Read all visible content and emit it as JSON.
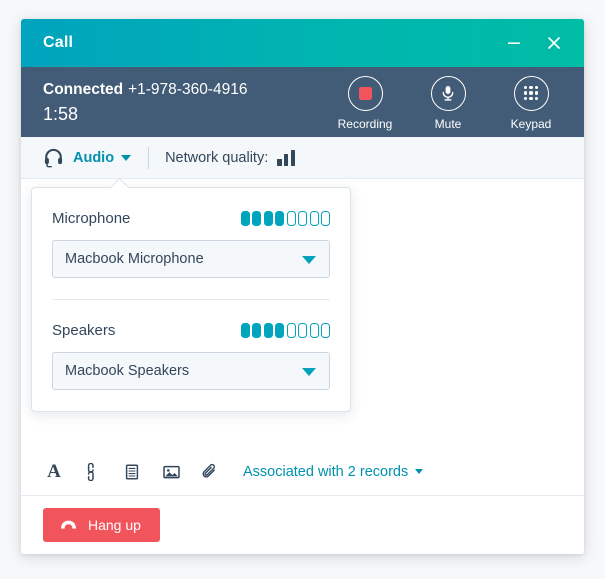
{
  "window": {
    "title": "Call",
    "minimize_icon": "minimize-icon",
    "close_icon": "close-icon"
  },
  "status": {
    "state_label": "Connected",
    "phone_number": "+1-978-360-4916",
    "timer": "1:58",
    "controls": [
      {
        "label": "Recording",
        "icon": "record-stop-icon"
      },
      {
        "label": "Mute",
        "icon": "microphone-icon"
      },
      {
        "label": "Keypad",
        "icon": "keypad-grid-icon"
      }
    ]
  },
  "audio_bar": {
    "headset_icon": "headset-icon",
    "audio_label": "Audio",
    "network_quality_label": "Network quality:",
    "signal_icon": "signal-bars-icon",
    "signal_bars_filled": 3,
    "signal_bars_total": 3
  },
  "audio_panel": {
    "microphone": {
      "title": "Microphone",
      "level_filled": 4,
      "level_total": 8,
      "selected_device": "Macbook Microphone"
    },
    "speakers": {
      "title": "Speakers",
      "level_filled": 4,
      "level_total": 8,
      "selected_device": "Macbook Speakers"
    }
  },
  "bottom_toolbar": {
    "icons": [
      {
        "name": "text-format-icon",
        "glyph": "A"
      },
      {
        "name": "link-icon",
        "glyph": ""
      },
      {
        "name": "snippet-icon",
        "glyph": ""
      },
      {
        "name": "image-icon",
        "glyph": ""
      },
      {
        "name": "attachment-clip-icon",
        "glyph": ""
      }
    ],
    "associated_label": "Associated with 2 records",
    "hangup_label": "Hang up",
    "hangup_icon": "phone-hangup-icon"
  },
  "colors": {
    "header_gradient_start": "#00a3bd",
    "header_gradient_end": "#00bda5",
    "status_bg": "#425b76",
    "teal_accent": "#0091ae",
    "meter_teal": "#00a4bd",
    "danger_red": "#f2545b",
    "text_dark": "#33475b"
  }
}
